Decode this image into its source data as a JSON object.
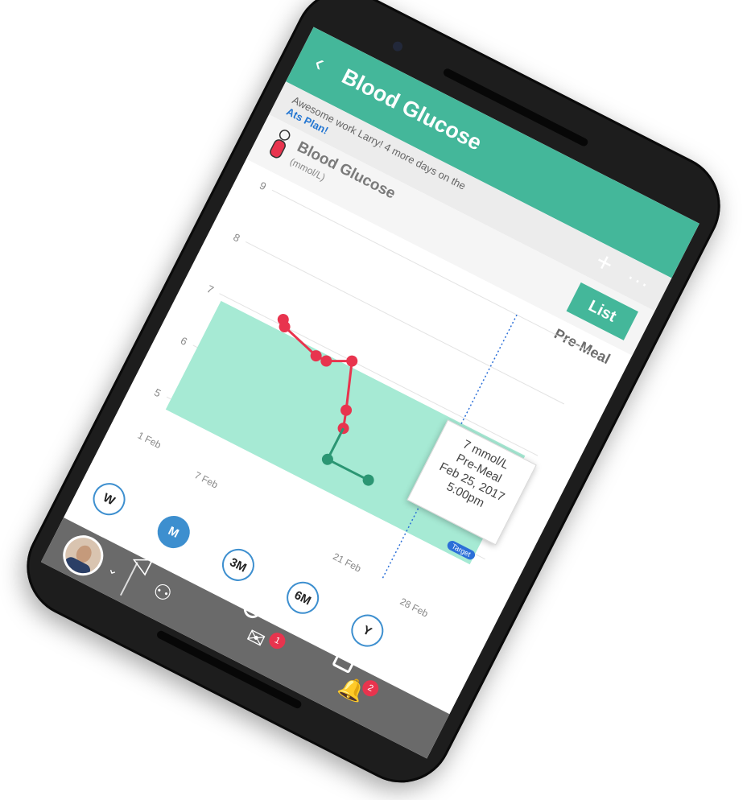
{
  "app_bar": {
    "title": "Blood Glucose",
    "back_icon": "arrow-left-icon",
    "add_icon": "plus-icon",
    "more_icon": "more-horizontal-icon"
  },
  "banner": {
    "text": "Awesome work Larry! 4 more days on the",
    "link": "Ats Plan!"
  },
  "metric": {
    "title": "Blood Glucose",
    "unit": "(mmol/L)",
    "list_label": "List",
    "filter_label": "Pre-Meal"
  },
  "tooltip": {
    "value": "7 mmol/L",
    "type": "Pre-Meal",
    "date": "Feb 25, 2017",
    "time": "5:00pm"
  },
  "target_badge": "Target",
  "chart_data": {
    "type": "line",
    "ylim": [
      4.7,
      9
    ],
    "y_ticks": [
      "9",
      "8",
      "7",
      "6",
      "5"
    ],
    "x_ticks": [
      "1 Feb",
      "7 Feb",
      "21 Feb",
      "28 Feb"
    ],
    "target_band": [
      4.8,
      6.9
    ],
    "series": [
      {
        "values_pink": [
          [
            7.1,
            7
          ],
          [
            7.0,
            7.4
          ],
          [
            6.8,
            11
          ],
          [
            6.8,
            12
          ],
          [
            7.0,
            14
          ],
          [
            6.2,
            15.5
          ],
          [
            5.9,
            16
          ]
        ]
      },
      {
        "values_green": [
          [
            5.3,
            16
          ],
          [
            5.3,
            20
          ]
        ]
      }
    ],
    "colors": {
      "above_target": "#e8344e",
      "in_target": "#2b9673",
      "band": "#a6ead4"
    }
  },
  "periods": [
    "W",
    "M",
    "3M",
    "6M",
    "Y"
  ],
  "active_period": "M",
  "bottom_icons": {
    "people": "people-icon",
    "chat": "chat-icon",
    "chat_badge": "1",
    "bell": "bell-icon",
    "bell_badge": "2"
  },
  "nav": {
    "back": "nav-back-icon",
    "home": "nav-home-icon",
    "recents": "nav-recents-icon"
  }
}
